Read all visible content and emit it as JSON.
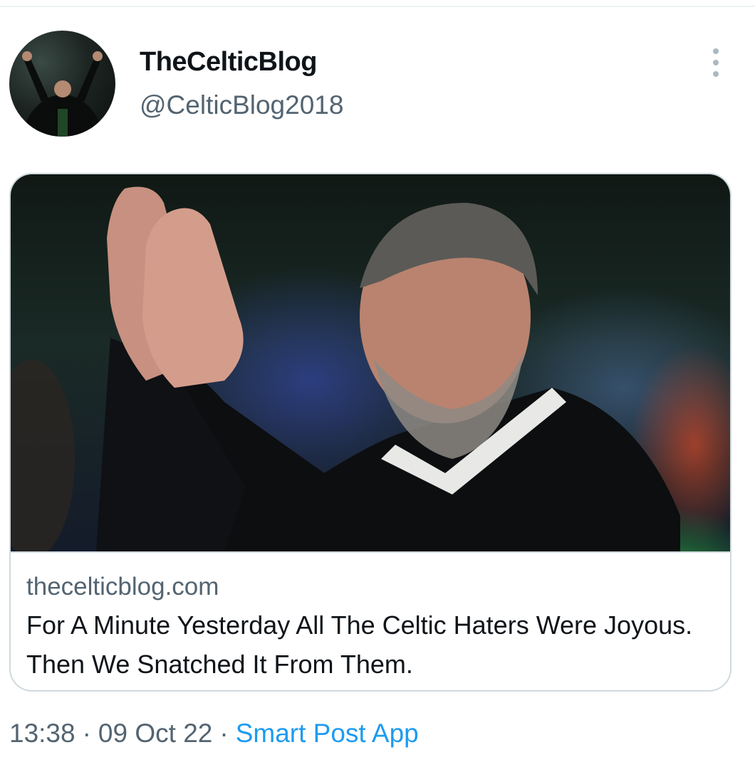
{
  "tweet": {
    "author": {
      "display_name": "TheCelticBlog",
      "handle": "@CelticBlog2018",
      "avatar_icon": "avatar-photo"
    },
    "more_icon": "more-vertical-icon",
    "card": {
      "domain": "thecelticblog.com",
      "title": "For A Minute Yesterday All The Celtic Haters Were Joyous. Then We Snatched It From Them."
    },
    "meta": {
      "time": "13:38",
      "date": "09 Oct 22",
      "separator": "·",
      "source": "Smart Post App"
    }
  },
  "colors": {
    "text_primary": "#0f1419",
    "text_secondary": "#536471",
    "link": "#1d9bf0",
    "border": "#cfd9de"
  }
}
